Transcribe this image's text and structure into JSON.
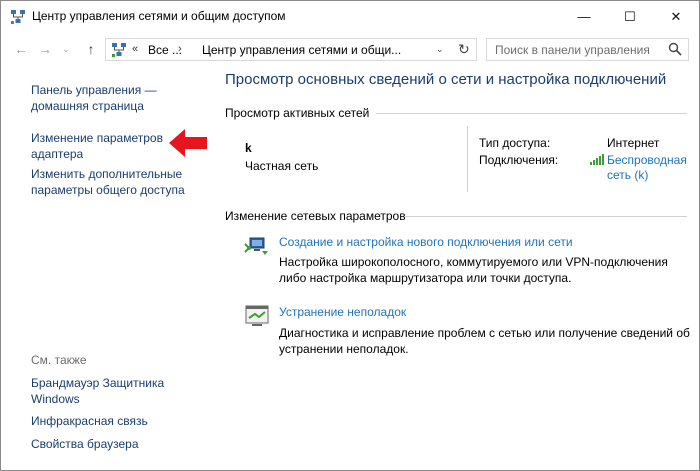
{
  "window": {
    "title": "Центр управления сетями и общим доступом",
    "minimize": "—",
    "maximize": "☐",
    "close": "✕"
  },
  "nav": {
    "back": "←",
    "forward": "→",
    "recent": "⌄",
    "up": "↑"
  },
  "address": {
    "chevron": "«",
    "all": "Все ...",
    "separator": "›",
    "crumb": "Центр управления сетями и общи...",
    "dropdown": "⌄",
    "refresh": "↻"
  },
  "search": {
    "placeholder": "Поиск в панели управления"
  },
  "sidebar": {
    "home_link": "Панель управления — домашняя страница",
    "adapter_link": "Изменение параметров адаптера",
    "sharing_link": "Изменить дополнительные параметры общего доступа",
    "see_also": "См. также",
    "firewall_link": "Брандмауэр Защитника Windows",
    "infrared_link": "Инфракрасная связь",
    "browser_link": "Свойства браузера"
  },
  "main": {
    "title": "Просмотр основных сведений о сети и настройка подключений",
    "active_networks_heading": "Просмотр активных сетей",
    "network_name": "k",
    "network_type": "Частная сеть",
    "access_label": "Тип доступа:",
    "access_value": "Интернет",
    "connections_label": "Подключения:",
    "connection_link": "Беспроводная сеть (k)",
    "change_heading": "Изменение сетевых параметров",
    "tasks": [
      {
        "link": "Создание и настройка нового подключения или сети",
        "description": "Настройка широкополосного, коммутируемого или VPN-подключения либо настройка маршрутизатора или точки доступа."
      },
      {
        "link": "Устранение неполадок",
        "description": "Диагностика и исправление проблем с сетью или получение сведений об устранении неполадок."
      }
    ]
  },
  "colors": {
    "link": "#1f74ba",
    "nav_link": "#1a3e6e",
    "arrow": "#e8141e",
    "signal": "#3aa035"
  }
}
